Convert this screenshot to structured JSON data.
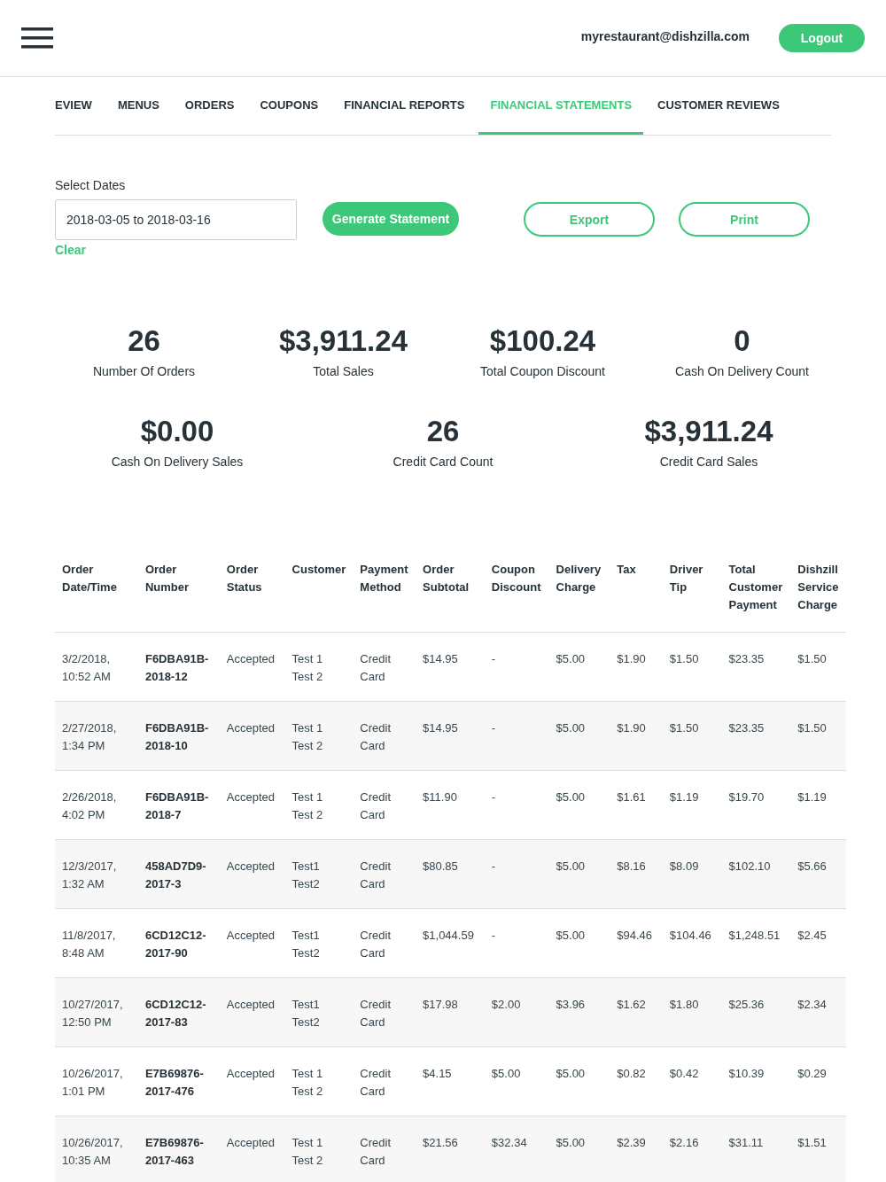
{
  "header": {
    "email": "myrestaurant@dishzilla.com",
    "logout": "Logout"
  },
  "tabs": [
    {
      "label": "EVIEW",
      "selected": false
    },
    {
      "label": "MENUS",
      "selected": false
    },
    {
      "label": "ORDERS",
      "selected": false
    },
    {
      "label": "COUPONS",
      "selected": false
    },
    {
      "label": "FINANCIAL REPORTS",
      "selected": false
    },
    {
      "label": "FINANCIAL STATEMENTS",
      "selected": true
    },
    {
      "label": "CUSTOMER REVIEWS",
      "selected": false
    }
  ],
  "filter": {
    "label": "Select Dates",
    "value": "2018-03-05 to 2018-03-16",
    "clear": "Clear",
    "generate": "Generate Statement",
    "export": "Export",
    "print": "Print"
  },
  "stat_rows": [
    {
      "stats": [
        {
          "value": "26",
          "label": "Number Of Orders"
        },
        {
          "value": "$3,911.24",
          "label": "Total Sales"
        },
        {
          "value": "$100.24",
          "label": "Total Coupon Discount"
        },
        {
          "value": "0",
          "label": "Cash On Delivery Count"
        }
      ]
    },
    {
      "stats": [
        {
          "value": "$0.00",
          "label": "Cash On Delivery Sales"
        },
        {
          "value": "26",
          "label": "Credit Card Count"
        },
        {
          "value": "$3,911.24",
          "label": "Credit Card Sales"
        }
      ]
    }
  ],
  "table": {
    "columns": [
      "Order\nDate/Time",
      "Order\nNumber",
      "Order\nStatus",
      "Customer",
      "Payment\nMethod",
      "Order\nSubtotal",
      "Coupon\nDiscount",
      "Delivery\nCharge",
      "Tax",
      "Driver\nTip",
      "Total\nCustomer\nPayment",
      "Dishzill\nService\nCharge"
    ],
    "rows": [
      [
        "3/2/2018,\n10:52 AM",
        "F6DBA91B-\n2018-12",
        "Accepted",
        "Test 1\nTest 2",
        "Credit\nCard",
        "$14.95",
        "-",
        "$5.00",
        "$1.90",
        "$1.50",
        "$23.35",
        "$1.50"
      ],
      [
        "2/27/2018,\n1:34 PM",
        "F6DBA91B-\n2018-10",
        "Accepted",
        "Test 1\nTest 2",
        "Credit\nCard",
        "$14.95",
        "-",
        "$5.00",
        "$1.90",
        "$1.50",
        "$23.35",
        "$1.50"
      ],
      [
        "2/26/2018,\n4:02 PM",
        "F6DBA91B-\n2018-7",
        "Accepted",
        "Test 1\nTest 2",
        "Credit\nCard",
        "$11.90",
        "-",
        "$5.00",
        "$1.61",
        "$1.19",
        "$19.70",
        "$1.19"
      ],
      [
        "12/3/2017,\n1:32 AM",
        "458AD7D9-\n2017-3",
        "Accepted",
        "Test1\nTest2",
        "Credit\nCard",
        "$80.85",
        "-",
        "$5.00",
        "$8.16",
        "$8.09",
        "$102.10",
        "$5.66"
      ],
      [
        "11/8/2017,\n8:48 AM",
        "6CD12C12-\n2017-90",
        "Accepted",
        "Test1\nTest2",
        "Credit\nCard",
        "$1,044.59",
        "-",
        "$5.00",
        "$94.46",
        "$104.46",
        "$1,248.51",
        "$2.45"
      ],
      [
        "10/27/2017,\n12:50 PM",
        "6CD12C12-\n2017-83",
        "Accepted",
        "Test1\nTest2",
        "Credit\nCard",
        "$17.98",
        "$2.00",
        "$3.96",
        "$1.62",
        "$1.80",
        "$25.36",
        "$2.34"
      ],
      [
        "10/26/2017,\n1:01 PM",
        "E7B69876-\n2017-476",
        "Accepted",
        "Test 1\nTest 2",
        "Credit\nCard",
        "$4.15",
        "$5.00",
        "$5.00",
        "$0.82",
        "$0.42",
        "$10.39",
        "$0.29"
      ],
      [
        "10/26/2017,\n10:35 AM",
        "E7B69876-\n2017-463",
        "Accepted",
        "Test 1\nTest 2",
        "Credit\nCard",
        "$21.56",
        "$32.34",
        "$5.00",
        "$2.39",
        "$2.16",
        "$31.11",
        "$1.51"
      ]
    ]
  }
}
